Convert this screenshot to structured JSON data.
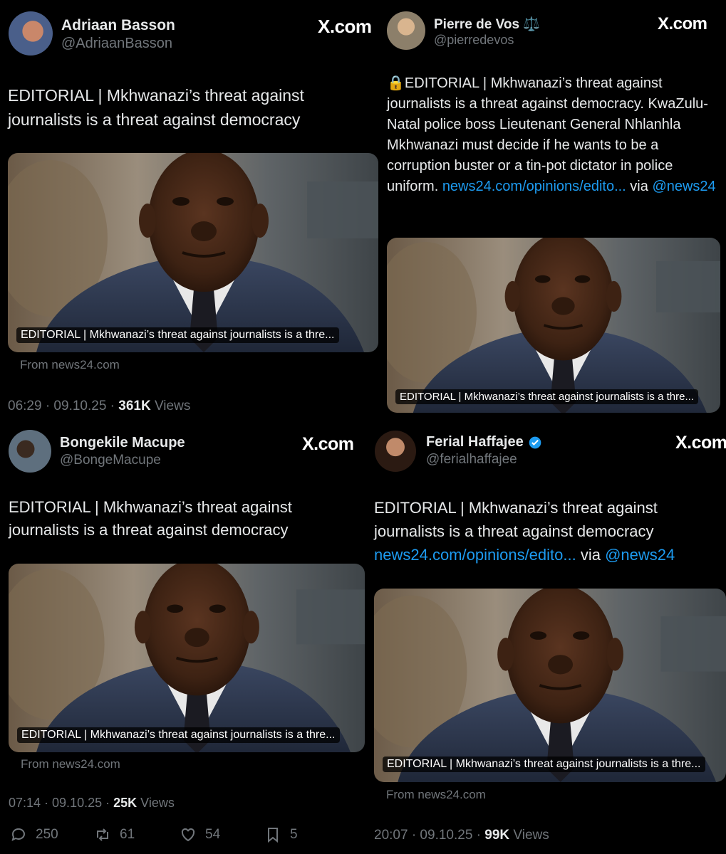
{
  "brand": "X.com",
  "posts": [
    {
      "name": "Adriaan Basson",
      "handle": "@AdriaanBasson",
      "text": "EDITORIAL | Mkhwanazi’s threat against journalists is a threat against democracy",
      "card_caption": "EDITORIAL | Mkhwanazi’s threat against journalists is a thre...",
      "source": "From news24.com",
      "time": "06:29 · 09.10.25 · ",
      "views_count": "361K",
      "views_label": " Views"
    },
    {
      "name": "Pierre de Vos",
      "name_emoji": "⚖️",
      "handle": "@pierredevos",
      "lock_emoji": "🔒",
      "text": "EDITORIAL | Mkhwanazi’s threat against journalists is a threat against democracy. KwaZulu-Natal police boss Lieutenant General Nhlanhla Mkhwanazi must decide if he wants to be a corruption buster or a tin-pot dictator in police uniform. ",
      "link": "news24.com/opinions/edito...",
      "via": " via ",
      "mention": "@news24",
      "card_caption": "EDITORIAL | Mkhwanazi’s threat against journalists is a thre..."
    },
    {
      "name": "Bongekile Macupe",
      "handle": "@BongeMacupe",
      "text": "EDITORIAL | Mkhwanazi’s threat against journalists is a threat against democracy",
      "card_caption": "EDITORIAL | Mkhwanazi’s threat against journalists is a thre...",
      "source": "From news24.com",
      "time": "07:14 · 09.10.25 · ",
      "views_count": "25K",
      "views_label": " Views",
      "replies": "250",
      "reposts": "61",
      "likes": "54",
      "bookmarks": "5"
    },
    {
      "name": "Ferial Haffajee",
      "handle": "@ferialhaffajee",
      "verified": true,
      "text": "EDITORIAL | Mkhwanazi’s threat against journalists is a threat against democracy",
      "link": "news24.com/opinions/edito...",
      "via": " via ",
      "mention": "@news24",
      "card_caption": "EDITORIAL | Mkhwanazi’s threat against journalists is a thre...",
      "source": "From news24.com",
      "time": "20:07 · 09.10.25 · ",
      "views_count": "99K",
      "views_label": " Views"
    }
  ],
  "colors": {
    "background": "#000000",
    "text": "#e7e9ea",
    "secondary": "#71767b",
    "link": "#1d9bf0",
    "verified": "#1d9bf0"
  },
  "icons": [
    "reply-icon",
    "repost-icon",
    "like-icon",
    "bookmark-icon",
    "share-icon",
    "verified-badge-icon",
    "lock-icon"
  ]
}
